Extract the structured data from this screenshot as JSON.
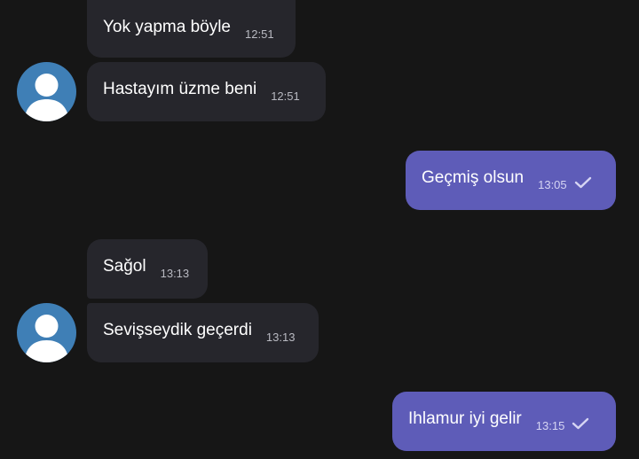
{
  "messages": [
    {
      "direction": "in",
      "text": "Yok yapma böyle",
      "time": "12:51"
    },
    {
      "direction": "in",
      "text": "Hastayım üzme beni",
      "time": "12:51"
    },
    {
      "direction": "out",
      "text": "Geçmiş olsun",
      "time": "13:05",
      "status_icon": "check-icon"
    },
    {
      "direction": "in",
      "text": "Sağol",
      "time": "13:13"
    },
    {
      "direction": "in",
      "text": "Sevişseydik geçerdi",
      "time": "13:13"
    },
    {
      "direction": "out",
      "text": "Ihlamur iyi gelir",
      "time": "13:15",
      "status_icon": "check-icon"
    }
  ],
  "colors": {
    "background": "#161616",
    "incoming_bubble": "#26262c",
    "outgoing_bubble": "#5e5cb8",
    "avatar": "#3f7fb6"
  }
}
